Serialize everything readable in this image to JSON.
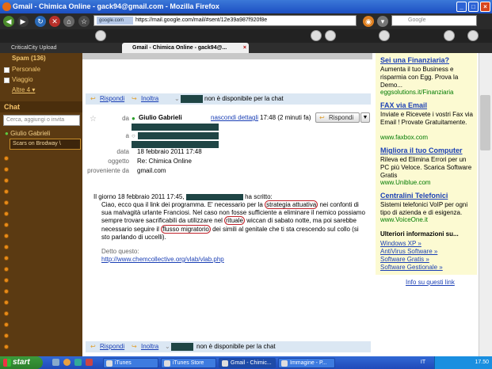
{
  "window": {
    "title": "Gmail - Chimica Online - gack94@gmail.com - Mozilla Firefox"
  },
  "browser": {
    "url_site": "google.com",
    "url": "https://mail.google.com/mail/#sent/12e39a987f920f8e",
    "search_placeholder": "Google",
    "tabs": [
      {
        "label": "CriticalCity Upload"
      },
      {
        "label": "Gmail - Chimica Online - gack94@..."
      }
    ]
  },
  "sidebar": {
    "spam": "Spam (136)",
    "labels": [
      "Personale",
      "Viaggio"
    ],
    "more": "Altre 4 ▾",
    "chat_title": "Chat",
    "chat_search_placeholder": "Cerca, aggiungi o invita",
    "contact": "Giulio Gabrieli",
    "status": "Scars on Brodway \\"
  },
  "replybar_top": {
    "reply": "Rispondi",
    "forward": "Inoltra",
    "status": "non è disponibile per la chat"
  },
  "message": {
    "sender": "Giulio Gabrieli",
    "hide_details": "nascondi dettagli",
    "time": "17:48 (2 minuti fa)",
    "reply_btn": "Rispondi",
    "fields": {
      "from_label": "da",
      "to_label": "a",
      "date_label": "data",
      "date": "18 febbraio 2011 17:48",
      "subject_label": "oggetto",
      "subject": "Re: Chimica Online",
      "source_label": "proveniente da",
      "source": "gmail.com"
    },
    "intro": "Il giorno 18 febbraio 2011 17:45,",
    "intro_end": "ha scritto:",
    "quote": {
      "l1a": "Ciao, ecco qua il link dei programma. E' necessario per la ",
      "l1b": "strategia attuativa",
      "l1c": " nei confonti di",
      "l2": "sua malvagità urlante Franciosi. Nel caso non fosse sufficiente a eliminare il nemico possiamo",
      "l3a": "sempre trovare sacrificabili da utilizzare nel ",
      "l3b": "rituale",
      "l3c": " wiccan di sabato notte, ma poi sarebbe",
      "l4a": "necessario seguire il ",
      "l4b": "flusso migratorio",
      "l4c": " dei simili al genitale che ti sta crescendo sul collo (si",
      "l5": "sto parlando di uccelli)."
    },
    "detto_label": "Detto questo:",
    "link": "http://www.chemcollective.org/vlab/vlab.php"
  },
  "replybar_bottom": {
    "reply": "Rispondi",
    "forward": "Inoltra",
    "status": "non è disponibile per la chat"
  },
  "ads": [
    {
      "title": "Sei una Finanziaria?",
      "text": "Aumenta il tuo Business e risparmia con Egg. Prova la Demo...",
      "url": "eggsolutions.it/Finanziaria"
    },
    {
      "title": "FAX via Email",
      "text": "Inviate e Ricevete i vostri Fax via Email ! Provate Gratuitamente.",
      "url": "www.faxbox.com"
    },
    {
      "title": "Migliora il tuo Computer",
      "text": "Rileva ed Elimina Errori per un PC più Veloce. Scarica Software Gratis",
      "url": "www.Uniblue.com"
    },
    {
      "title": "Centralini Telefonici",
      "text": "Sistemi telefonici VoIP per ogni tipo di azienda e di esigenza.",
      "url": "www.VoiceOne.it"
    }
  ],
  "more_info": {
    "title": "Ulteriori informazioni su...",
    "links": [
      "Windows XP »",
      "AntiVirus Software »",
      "Software Gratis »",
      "Software Gestionale »"
    ],
    "info_link": "Info su questi link"
  },
  "taskbar": {
    "start": "start",
    "tasks": [
      "iTunes",
      "iTunes Store",
      "Gmail - Chimic...",
      "Immagine - P..."
    ],
    "lang": "IT",
    "clock": "17.50"
  }
}
